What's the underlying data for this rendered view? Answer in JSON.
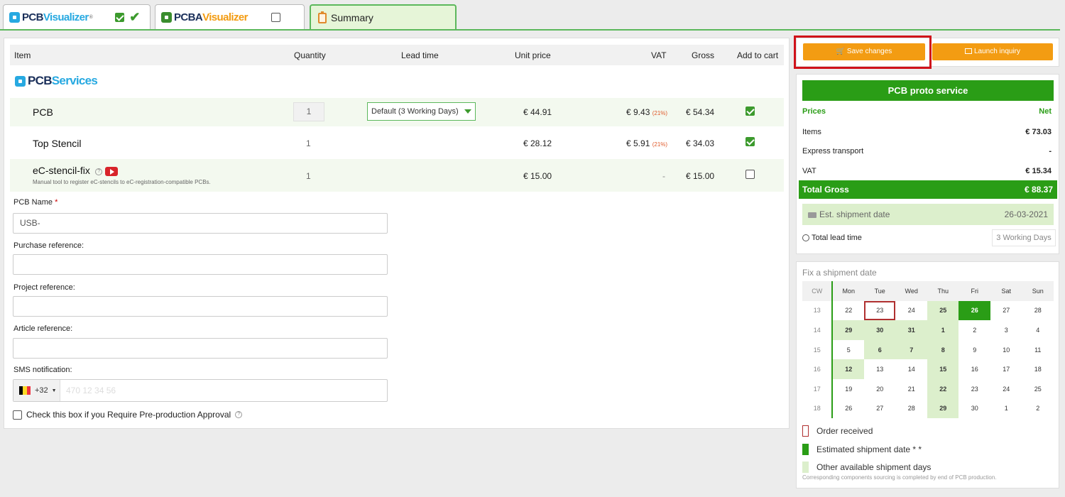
{
  "tabs": [
    {
      "pcb": "PCB",
      "name": "Visualizer",
      "tm": "®"
    },
    {
      "pcb": "PCBA",
      "name": "Visualizer"
    },
    {
      "label": "Summary"
    }
  ],
  "table": {
    "headers": [
      "Item",
      "Quantity",
      "Lead time",
      "Unit price",
      "VAT",
      "Gross",
      "Add to cart"
    ],
    "service_logo": {
      "pcb": "PCB",
      "services": "Services"
    },
    "rows": [
      {
        "name": "PCB",
        "qty": "1",
        "lead_time": "Default (3 Working Days)",
        "unit_price": "€ 44.91",
        "vat": "€ 9.43",
        "vat_pct": "(21%)",
        "gross": "€ 54.34",
        "in_cart": true
      },
      {
        "name": "Top Stencil",
        "qty": "1",
        "unit_price": "€ 28.12",
        "vat": "€ 5.91",
        "vat_pct": "(21%)",
        "gross": "€ 34.03",
        "in_cart": true
      },
      {
        "name": "eC-stencil-fix",
        "help": "?",
        "desc": "Manual tool to register eC-stencils to eC-registration-compatible PCBs.",
        "qty": "1",
        "unit_price": "€ 15.00",
        "vat": "-",
        "gross": "€ 15.00",
        "in_cart": false
      }
    ]
  },
  "form": {
    "pcb_name_label": "PCB Name",
    "required_mark": "*",
    "pcb_name_value": "USB-",
    "purchase_ref_label": "Purchase reference:",
    "project_ref_label": "Project reference:",
    "article_ref_label": "Article reference:",
    "sms_label": "SMS notification:",
    "country_code": "+32",
    "phone_placeholder": "470 12 34 56",
    "approval_label": "Check this box if you Require Pre-production Approval",
    "help": "?"
  },
  "actions": {
    "save": "Save changes",
    "launch": "Launch inquiry"
  },
  "summary": {
    "title": "PCB proto service",
    "prices_label": "Prices",
    "net_label": "Net",
    "items_label": "Items",
    "items_value": "€ 73.03",
    "express_label": "Express transport",
    "express_value": "-",
    "vat_label": "VAT",
    "vat_value": "€ 15.34",
    "total_label": "Total Gross",
    "total_value": "€ 88.37",
    "ship_label": "Est. shipment date",
    "ship_value": "26-03-2021",
    "lead_label": "Total lead time",
    "lead_value": "3 Working Days"
  },
  "calendar": {
    "title": "Fix a shipment date",
    "headers": [
      "CW",
      "Mon",
      "Tue",
      "Wed",
      "Thu",
      "Fri",
      "Sat",
      "Sun"
    ],
    "weeks": [
      {
        "cw": "13",
        "days": [
          "22",
          "23",
          "24",
          "25",
          "26",
          "27",
          "28"
        ]
      },
      {
        "cw": "14",
        "days": [
          "29",
          "30",
          "31",
          "1",
          "2",
          "3",
          "4"
        ]
      },
      {
        "cw": "15",
        "days": [
          "5",
          "6",
          "7",
          "8",
          "9",
          "10",
          "11"
        ]
      },
      {
        "cw": "16",
        "days": [
          "12",
          "13",
          "14",
          "15",
          "16",
          "17",
          "18"
        ]
      },
      {
        "cw": "17",
        "days": [
          "19",
          "20",
          "21",
          "22",
          "23",
          "24",
          "25"
        ]
      },
      {
        "cw": "18",
        "days": [
          "26",
          "27",
          "28",
          "29",
          "30",
          "1",
          "2"
        ]
      }
    ],
    "legend_received": "Order received",
    "legend_estimated": "Estimated shipment date * *",
    "legend_available": "Other available shipment days",
    "footnote": "Corresponding components sourcing is completed by end of PCB production."
  },
  "colors": {
    "accent_green": "#2a9d16",
    "orange": "#f39c12",
    "highlight_red": "#d0121a",
    "light_green": "#dcefcc"
  }
}
